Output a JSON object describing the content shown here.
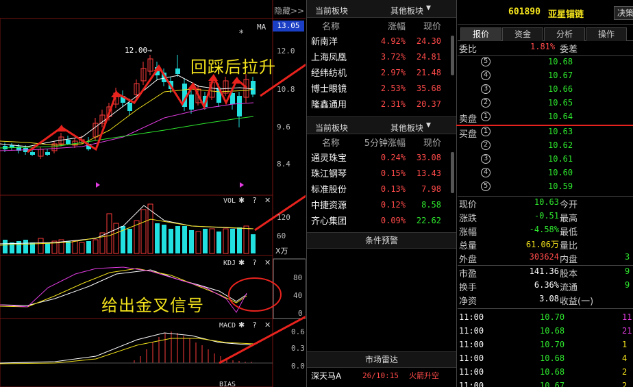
{
  "chart": {
    "hide_label": "隐藏>>",
    "ma_label": "MA",
    "current_price": "13.05",
    "peak_label": "12.00→",
    "star": "*",
    "price_ticks": [
      "12.0",
      "10.8",
      "9.6",
      "8.4"
    ],
    "vol_label": "VOL",
    "vol_ticks": [
      "120",
      "60"
    ],
    "vol_unit": "X万",
    "kdj_label": "KDJ",
    "kdj_ticks": [
      "80",
      "40",
      "0"
    ],
    "macd_label": "MACD",
    "macd_ticks": [
      "0.6",
      "0.3",
      "0.0"
    ],
    "bias_label": "BIAS",
    "tools": "✱ ? ✕",
    "annotation_top": "回踩后拉升",
    "annotation_bottom": "给出金叉信号",
    "colors": {
      "up": "#ff3b3b",
      "down": "#22e0e0",
      "arrow": "#e8231e",
      "ma5": "#ffffff",
      "ma10": "#f3e21c",
      "ma20": "#e23ce2",
      "ma60": "#2ee82e"
    }
  },
  "sector1": {
    "title": "当前板块",
    "other": "其他板块",
    "columns": [
      "名称",
      "涨幅",
      "现价"
    ],
    "rows": [
      {
        "name": "新南洋",
        "chg": "4.92%",
        "price": "24.30"
      },
      {
        "name": "上海凤凰",
        "chg": "3.72%",
        "price": "24.81"
      },
      {
        "name": "经纬纺机",
        "chg": "2.97%",
        "price": "21.48"
      },
      {
        "name": "博士眼镜",
        "chg": "2.53%",
        "price": "35.68"
      },
      {
        "name": "隆鑫通用",
        "chg": "2.31%",
        "price": "20.37"
      }
    ]
  },
  "sector2": {
    "title": "当前板块",
    "other": "其他板块",
    "columns": [
      "名称",
      "5分钟涨幅",
      "现价"
    ],
    "rows": [
      {
        "name": "通灵珠宝",
        "chg": "0.24%",
        "price": "33.08",
        "pc": "red"
      },
      {
        "name": "珠江钢琴",
        "chg": "0.15%",
        "price": "13.43",
        "pc": "red"
      },
      {
        "name": "标准股份",
        "chg": "0.13%",
        "price": "7.98",
        "pc": "red"
      },
      {
        "name": "中捷资源",
        "chg": "0.12%",
        "price": "8.58",
        "pc": "green"
      },
      {
        "name": "齐心集团",
        "chg": "0.09%",
        "price": "22.62",
        "pc": "green"
      }
    ]
  },
  "alert": {
    "title": "条件预警"
  },
  "radar": {
    "title": "市场雷达",
    "rows": [
      {
        "name": "深天马A",
        "time": "26/10:15",
        "event": "火箭升空"
      }
    ]
  },
  "stock": {
    "code": "601890",
    "name": "亚星锚链",
    "btn": "决策",
    "tabs": [
      "报价",
      "资金",
      "分析",
      "操作"
    ],
    "weibi_label": "委比",
    "weibi": "1.81%",
    "weicha_label": "委差",
    "sell_label": "卖盘",
    "buy_label": "买盘",
    "sells": [
      {
        "lvl": "5",
        "price": "10.68"
      },
      {
        "lvl": "4",
        "price": "10.67"
      },
      {
        "lvl": "3",
        "price": "10.66"
      },
      {
        "lvl": "2",
        "price": "10.65"
      },
      {
        "lvl": "1",
        "price": "10.64"
      }
    ],
    "buys": [
      {
        "lvl": "1",
        "price": "10.63"
      },
      {
        "lvl": "2",
        "price": "10.62"
      },
      {
        "lvl": "3",
        "price": "10.61"
      },
      {
        "lvl": "4",
        "price": "10.60"
      },
      {
        "lvl": "5",
        "price": "10.59"
      }
    ],
    "quote": [
      {
        "k1": "现价",
        "v1": "10.63",
        "c1": "green",
        "k2": "今开",
        "v2": ""
      },
      {
        "k1": "涨跌",
        "v1": "-0.51",
        "c1": "green",
        "k2": "最高",
        "v2": ""
      },
      {
        "k1": "涨幅",
        "v1": "-4.58%",
        "c1": "green",
        "k2": "最低",
        "v2": ""
      },
      {
        "k1": "总量",
        "v1": "61.06万",
        "c1": "yellow",
        "k2": "量比",
        "v2": ""
      },
      {
        "k1": "外盘",
        "v1": "303624",
        "c1": "red",
        "k2": "内盘",
        "v2": "3"
      },
      {
        "k1": "市盈",
        "v1": "141.36",
        "c1": "white",
        "k2": "股本",
        "v2": "9"
      },
      {
        "k1": "换手",
        "v1": "6.36%",
        "c1": "white",
        "k2": "流通",
        "v2": "9"
      },
      {
        "k1": "净资",
        "v1": "3.08",
        "c1": "white",
        "k2": "收益(一)",
        "v2": ""
      }
    ],
    "ticks": [
      {
        "time": "11:00",
        "price": "10.70",
        "vol": "11",
        "vc": "magenta"
      },
      {
        "time": "11:00",
        "price": "10.68",
        "vol": "21",
        "vc": "magenta"
      },
      {
        "time": "11:00",
        "price": "10.70",
        "vol": "1",
        "vc": "yellow"
      },
      {
        "time": "11:00",
        "price": "10.68",
        "vol": "4",
        "vc": "yellow"
      },
      {
        "time": "11:00",
        "price": "10.68",
        "vol": "2",
        "vc": "yellow"
      },
      {
        "time": "11:00",
        "price": "10.67",
        "vol": "2",
        "vc": "yellow"
      }
    ]
  }
}
